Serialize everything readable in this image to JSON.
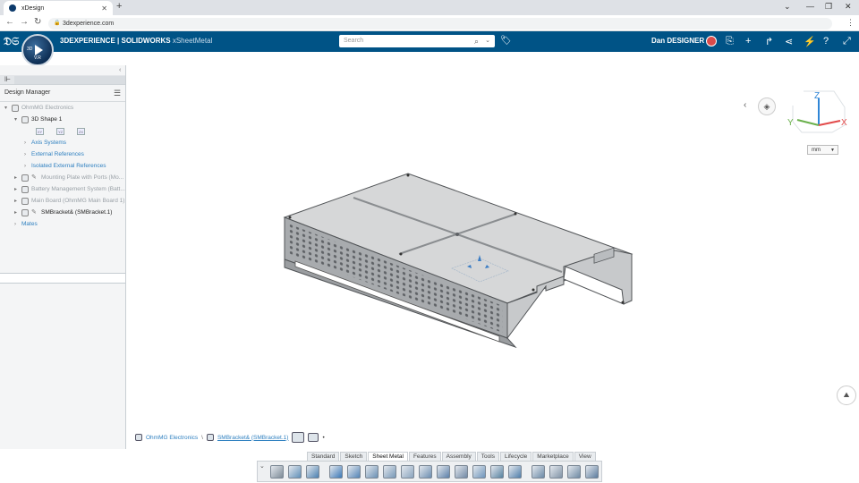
{
  "browser": {
    "tab_title": "xDesign",
    "url": "3dexperience.com",
    "new_tab": "+"
  },
  "app": {
    "brand_bold": "3DEXPERIENCE | SOLIDWORKS",
    "brand_light": "xSheetMetal",
    "search_placeholder": "Search",
    "user_name": "Dan DESIGNER",
    "compass_version": "V.R",
    "compass_label": "3D"
  },
  "left_panel": {
    "title": "Design Manager",
    "tree": [
      {
        "label": "OhmMG Electronics",
        "style": "grey"
      },
      {
        "label": "3D Shape 1",
        "style": "dark"
      },
      {
        "label": "Axis Systems",
        "style": "blue"
      },
      {
        "label": "External References",
        "style": "blue"
      },
      {
        "label": "Isolated External References",
        "style": "blue"
      },
      {
        "label": "Mounting Plate with Ports (Mo...",
        "style": "grey"
      },
      {
        "label": "Battery Management System (Batt...",
        "style": "grey"
      },
      {
        "label": "Main Board (OhmMG Main Board 1)",
        "style": "grey"
      },
      {
        "label": "SMBracket& (SMBracket.1)",
        "style": "dark"
      },
      {
        "label": "Mates",
        "style": "blue"
      }
    ],
    "planes": [
      "XY",
      "YZ",
      "ZX"
    ]
  },
  "canvas": {
    "unit": "mm",
    "axis_labels": {
      "z": "Z",
      "y": "Y",
      "x": "X"
    }
  },
  "breadcrumb": {
    "root": "OhmMG Electronics",
    "separator": "\\",
    "current": "SMBracket& (SMBracket.1)"
  },
  "action_bar": {
    "tabs": [
      "Standard",
      "Sketch",
      "Sheet Metal",
      "Features",
      "Assembly",
      "Tools",
      "Lifecycle",
      "Marketplace",
      "View"
    ],
    "active_tab": "Sheet Metal",
    "tools": [
      "properties-icon",
      "move-icon",
      "flange-icon",
      "base-flange-icon",
      "edge-flange-icon",
      "hem-icon",
      "tab-icon",
      "miter-icon",
      "jog-icon",
      "sketched-bend-icon",
      "closed-corner-icon",
      "lofted-bend-icon",
      "unfold-icon",
      "fold-icon",
      "flatten-icon",
      "cut-icon",
      "forming-icon",
      "insert-bends-icon"
    ]
  }
}
